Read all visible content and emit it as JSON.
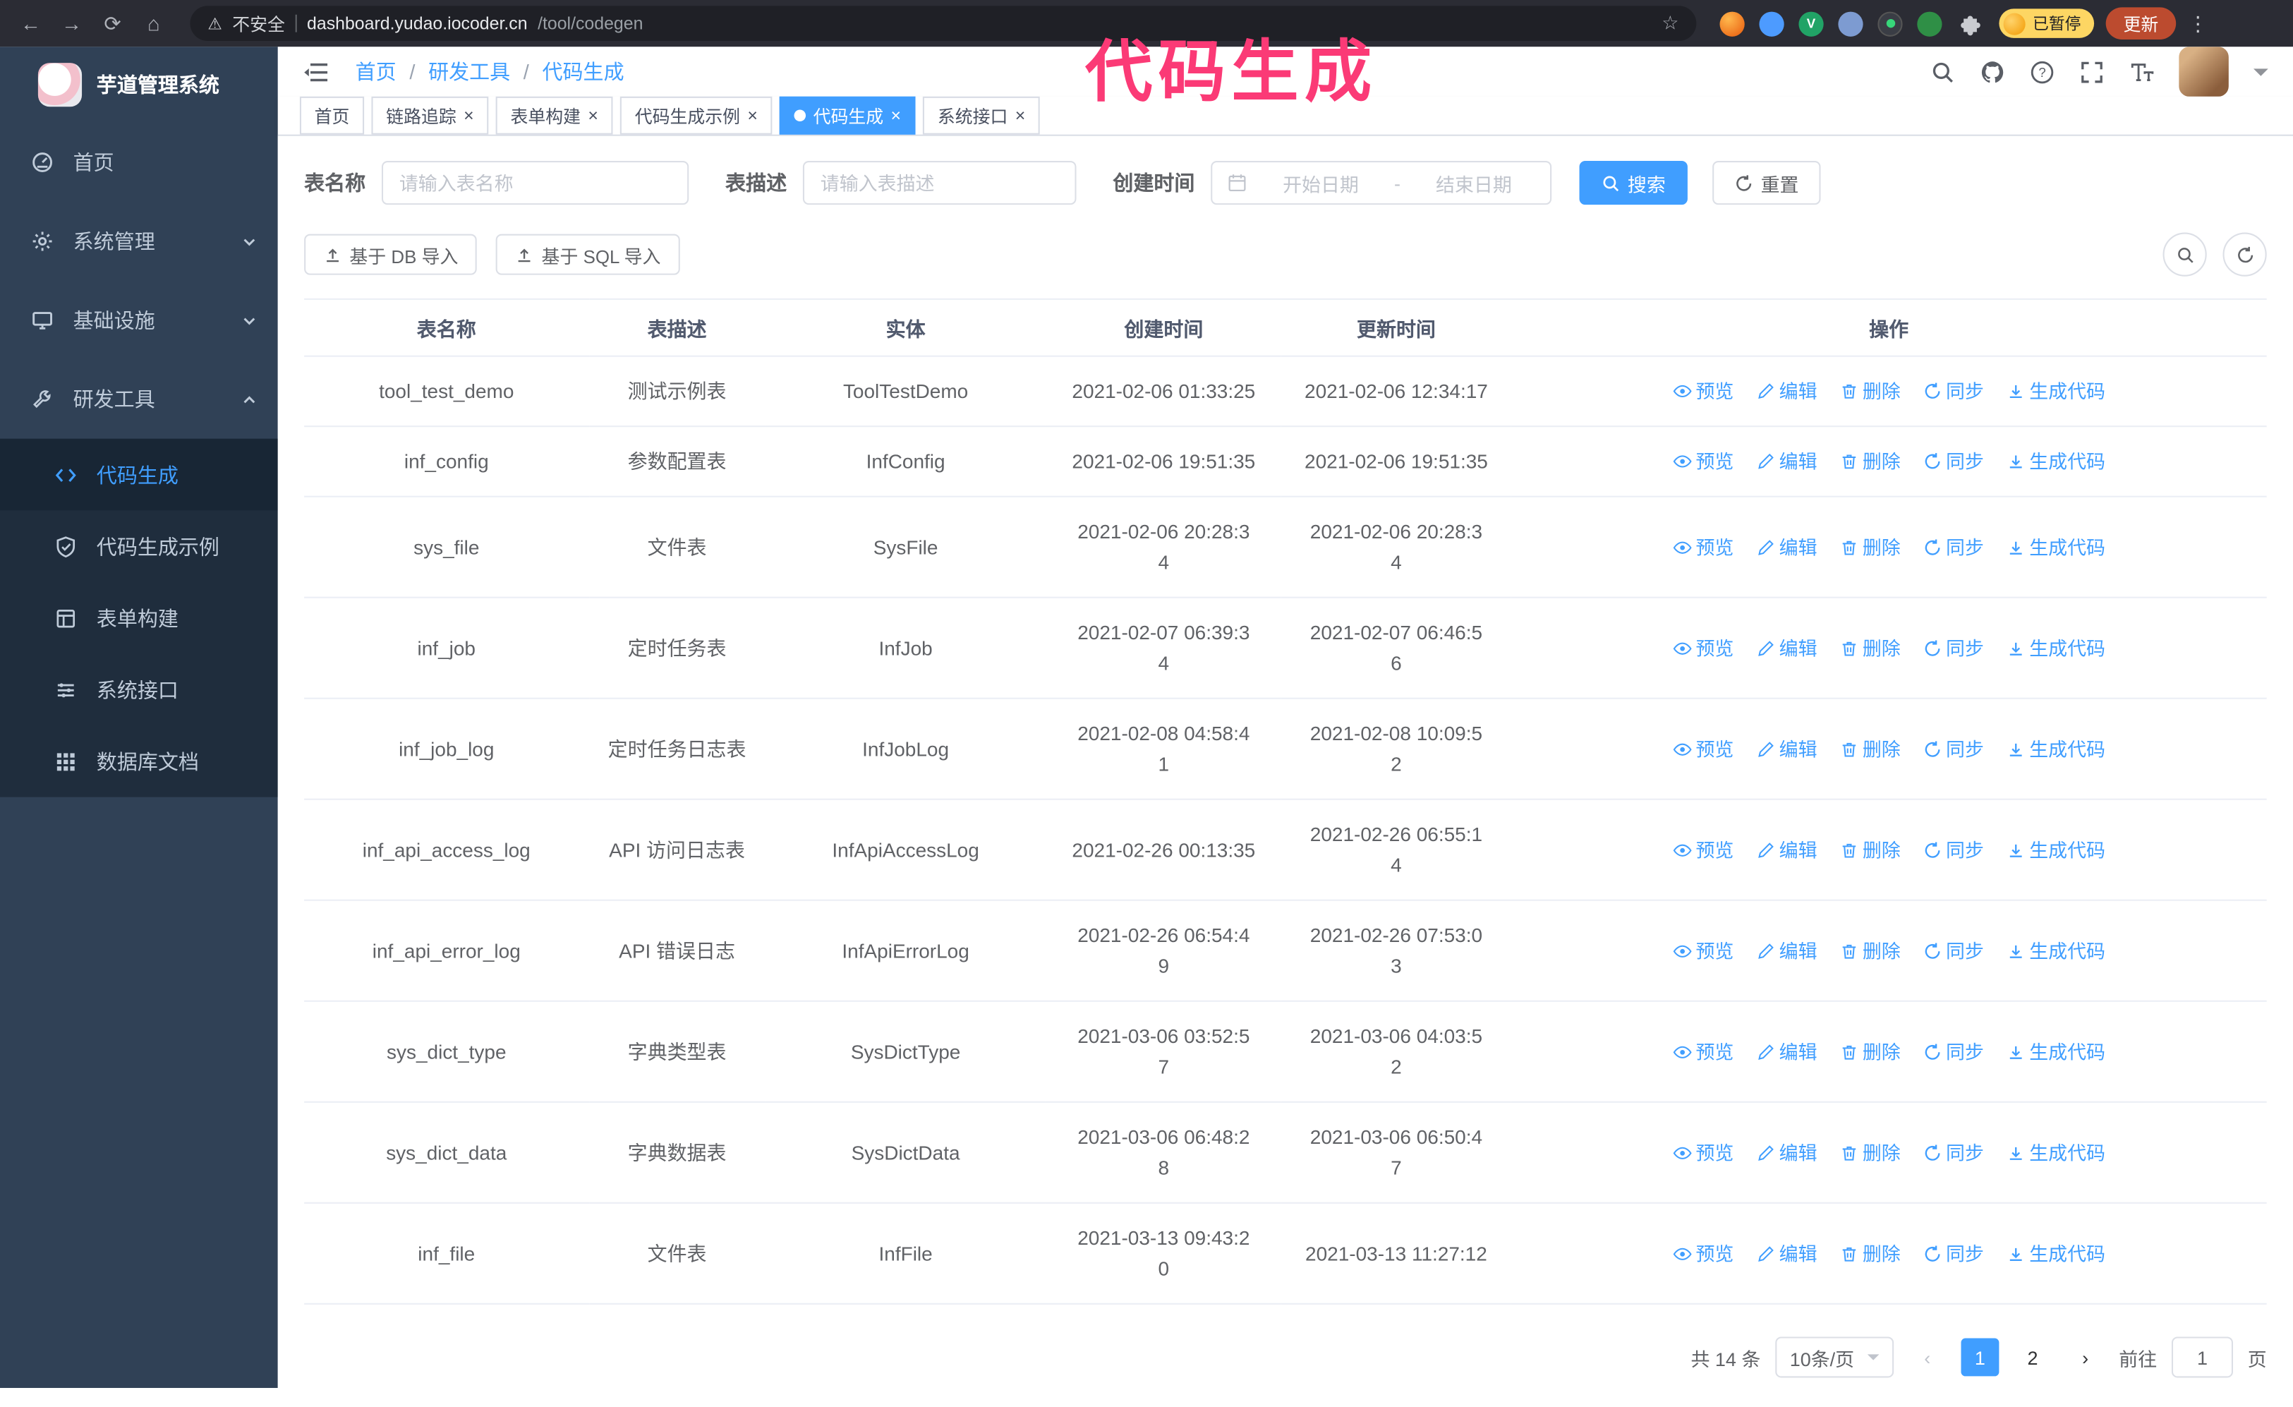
{
  "browser": {
    "security_label": "不安全",
    "url_domain": "dashboard.yudao.iocoder.cn",
    "url_path": "/tool/codegen",
    "paused_badge": "已暂停",
    "update_button": "更新"
  },
  "annotation": {
    "text": "代码生成",
    "color": "#fb3a76"
  },
  "colors": {
    "primary": "#409eff",
    "sidebar_bg": "#304156",
    "submenu_bg": "#1f2d3d",
    "chrome_bg": "#2b2c34",
    "annotation_pink": "#fb3a76"
  },
  "icons": {
    "back-icon": "←",
    "forward-icon": "→",
    "reload-icon": "⟳",
    "home-icon": "⌂",
    "warning-icon": "⚠",
    "star-icon": "☆",
    "kebab-icon": "⋮",
    "search-icon": "magnifier-svg",
    "github-icon": "octocat-svg",
    "question-icon": "?-circle",
    "fullscreen-icon": "corners-svg",
    "font-size-icon": "TT-svg",
    "calendar-icon": "calendar-svg",
    "refresh-icon": "circular-arrow-svg",
    "eye-icon": "eye-svg",
    "edit-icon": "pencil-svg",
    "delete-icon": "trash-svg",
    "sync-icon": "circular-arrow-svg",
    "generate-icon": "download-svg",
    "upload-icon": "up-arrow-svg"
  },
  "sidebar": {
    "logo_title": "芋道管理系统",
    "items": [
      {
        "label": "首页"
      },
      {
        "label": "系统管理"
      },
      {
        "label": "基础设施"
      },
      {
        "label": "研发工具"
      }
    ],
    "submenu": [
      {
        "label": "代码生成",
        "active": true
      },
      {
        "label": "代码生成示例"
      },
      {
        "label": "表单构建"
      },
      {
        "label": "系统接口"
      },
      {
        "label": "数据库文档"
      }
    ]
  },
  "header": {
    "breadcrumb": [
      "首页",
      "研发工具",
      "代码生成"
    ]
  },
  "tabs": [
    {
      "label": "首页",
      "closable": false,
      "active": false
    },
    {
      "label": "链路追踪",
      "closable": true,
      "active": false
    },
    {
      "label": "表单构建",
      "closable": true,
      "active": false
    },
    {
      "label": "代码生成示例",
      "closable": true,
      "active": false
    },
    {
      "label": "代码生成",
      "closable": true,
      "active": true
    },
    {
      "label": "系统接口",
      "closable": true,
      "active": false
    }
  ],
  "filters": {
    "name_label": "表名称",
    "name_placeholder": "请输入表名称",
    "desc_label": "表描述",
    "desc_placeholder": "请输入表描述",
    "time_label": "创建时间",
    "start_placeholder": "开始日期",
    "range_separator": "-",
    "end_placeholder": "结束日期",
    "search_button": "搜索",
    "reset_button": "重置",
    "import_db_button": "基于 DB 导入",
    "import_sql_button": "基于 SQL 导入"
  },
  "table": {
    "columns": [
      "表名称",
      "表描述",
      "实体",
      "创建时间",
      "更新时间",
      "操作"
    ],
    "op_labels": {
      "preview": "预览",
      "edit": "编辑",
      "delete": "删除",
      "sync": "同步",
      "generate": "生成代码"
    },
    "rows": [
      {
        "name": "tool_test_demo",
        "desc": "测试示例表",
        "entity": "ToolTestDemo",
        "created": "2021-02-06 01:33:25",
        "updated": "2021-02-06 12:34:17"
      },
      {
        "name": "inf_config",
        "desc": "参数配置表",
        "entity": "InfConfig",
        "created": "2021-02-06 19:51:35",
        "updated": "2021-02-06 19:51:35"
      },
      {
        "name": "sys_file",
        "desc": "文件表",
        "entity": "SysFile",
        "created": "2021-02-06 20:28:3\n4",
        "updated": "2021-02-06 20:28:3\n4"
      },
      {
        "name": "inf_job",
        "desc": "定时任务表",
        "entity": "InfJob",
        "created": "2021-02-07 06:39:3\n4",
        "updated": "2021-02-07 06:46:5\n6"
      },
      {
        "name": "inf_job_log",
        "desc": "定时任务日志表",
        "entity": "InfJobLog",
        "created": "2021-02-08 04:58:4\n1",
        "updated": "2021-02-08 10:09:5\n2"
      },
      {
        "name": "inf_api_access_log",
        "desc": "API 访问日志表",
        "entity": "InfApiAccessLog",
        "created": "2021-02-26 00:13:35",
        "updated": "2021-02-26 06:55:1\n4"
      },
      {
        "name": "inf_api_error_log",
        "desc": "API 错误日志",
        "entity": "InfApiErrorLog",
        "created": "2021-02-26 06:54:4\n9",
        "updated": "2021-02-26 07:53:0\n3"
      },
      {
        "name": "sys_dict_type",
        "desc": "字典类型表",
        "entity": "SysDictType",
        "created": "2021-03-06 03:52:5\n7",
        "updated": "2021-03-06 04:03:5\n2"
      },
      {
        "name": "sys_dict_data",
        "desc": "字典数据表",
        "entity": "SysDictData",
        "created": "2021-03-06 06:48:2\n8",
        "updated": "2021-03-06 06:50:4\n7"
      },
      {
        "name": "inf_file",
        "desc": "文件表",
        "entity": "InfFile",
        "created": "2021-03-13 09:43:2\n0",
        "updated": "2021-03-13 11:27:12"
      }
    ]
  },
  "pagination": {
    "total": "共 14 条",
    "page_size": "10条/页",
    "pages": [
      "1",
      "2"
    ],
    "active_page": "1",
    "goto_label": "前往",
    "goto_value": "1",
    "page_unit": "页"
  }
}
